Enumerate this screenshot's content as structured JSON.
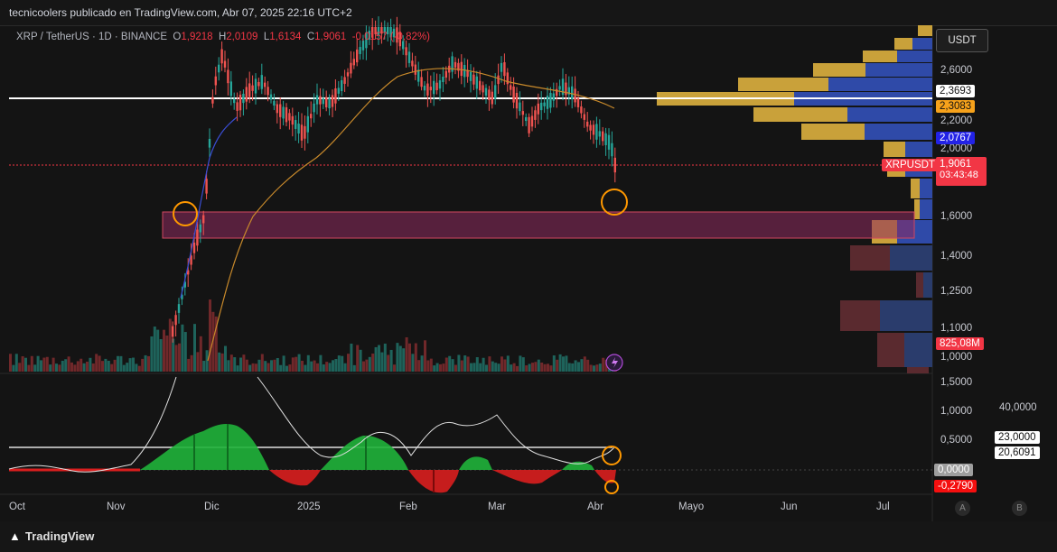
{
  "header": {
    "publisher": "tecnicoolers publicado en TradingView.com, Abr 07, 2025 22:16 UTC+2"
  },
  "legend": {
    "symbol": "XRP / TetherUS · 1D · BINANCE",
    "open_label": "O",
    "open": "1,9218",
    "high_label": "H",
    "high": "2,0109",
    "low_label": "L",
    "low": "1,6134",
    "close_label": "C",
    "close": "1,9061",
    "change": "-0,0157 (-0,82%)"
  },
  "currency_button": "USDT",
  "price_axis": [
    "2,6000",
    "2,2000",
    "2,0000",
    "1,6000",
    "1,4000",
    "1,2500",
    "1,1000",
    "1,0000"
  ],
  "price_tags": {
    "level_white": "2,3693",
    "level_orange": "2,3083",
    "level_blue": "2,0767",
    "symbol_tag": "XRPUSDT",
    "last_price": "1,9061",
    "countdown": "03:43:48",
    "volume": "825,08M"
  },
  "osc_axis": [
    "1,5000",
    "1,0000",
    "0,5000"
  ],
  "osc_tags": {
    "right_scale": "40,0000",
    "value_a": "23,0000",
    "value_b": "20,6091",
    "zero": "0,0000",
    "neg": "-0,2790"
  },
  "time_axis": [
    "Oct",
    "Nov",
    "Dic",
    "2025",
    "Feb",
    "Mar",
    "Abr",
    "Mayo",
    "Jun",
    "Jul"
  ],
  "scale_buttons": [
    "A",
    "B"
  ],
  "footer": {
    "logo_text": "TradingView"
  },
  "colors": {
    "up": "#26a69a",
    "down": "#ef5350",
    "zone": "#8e2a5e",
    "vp_blue": "#2f4aa8",
    "vp_gold": "#c9a13a",
    "sma": "#c98a2b",
    "osc_green": "#1fb33a",
    "osc_red": "#d91e1e",
    "marker": "#ff9800"
  },
  "icons": [
    "lightning-icon",
    "tradingview-logo-icon"
  ]
}
